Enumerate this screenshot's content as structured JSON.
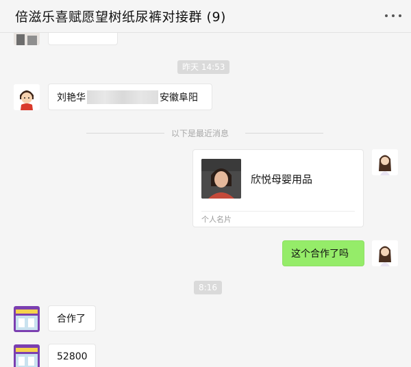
{
  "header": {
    "title": "倍滋乐喜赋愿望树纸尿裤对接群 (9)"
  },
  "timestamps": {
    "yesterday": "昨天 14:53",
    "today": "8:16"
  },
  "divider": {
    "label": "以下是最近消息"
  },
  "messages": {
    "m1": {
      "prefix": "刘艳华",
      "suffix": "安徽阜阳"
    },
    "card": {
      "name": "欣悦母婴用品",
      "type": "个人名片"
    },
    "m2": {
      "text": "这个合作了吗"
    },
    "m3": {
      "text": "合作了"
    },
    "m4": {
      "text": "52800"
    }
  },
  "colors": {
    "background": "#f5f5f5",
    "sent_bubble": "#95ec69",
    "received_bubble": "#ffffff",
    "time_pill": "#dadada"
  },
  "icons": {
    "more": "more-horizontal-icon"
  }
}
